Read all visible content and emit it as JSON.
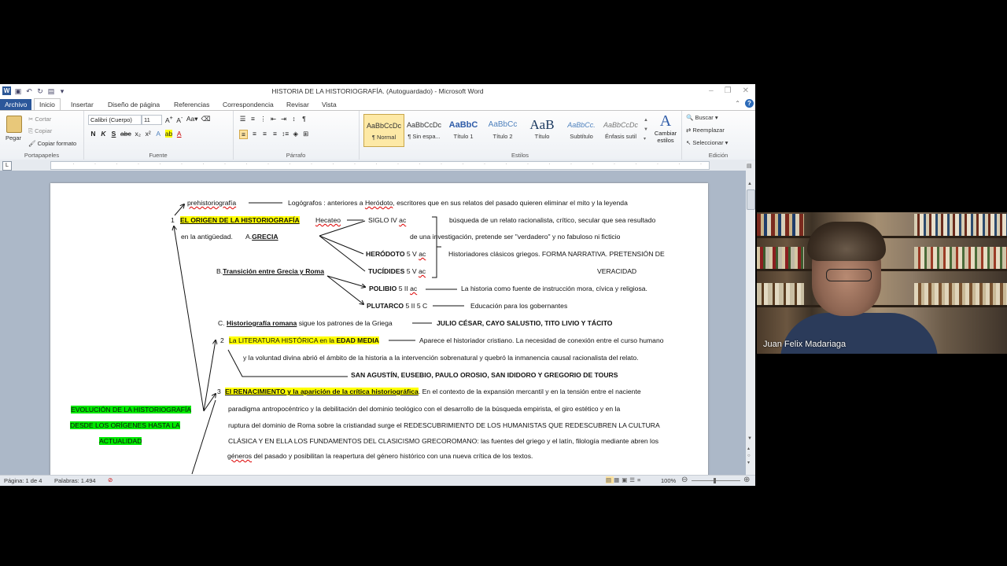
{
  "window": {
    "title": "HISTORIA DE LA HISTORIOGRAFÍA. (Autoguardado) - Microsoft Word",
    "app_icon": "W"
  },
  "ribbon_tabs": [
    "Archivo",
    "Inicio",
    "Insertar",
    "Diseño de página",
    "Referencias",
    "Correspondencia",
    "Revisar",
    "Vista"
  ],
  "clipboard": {
    "paste": "Pegar",
    "cut": "Cortar",
    "copy": "Copiar",
    "format_painter": "Copiar formato",
    "label": "Portapapeles"
  },
  "font": {
    "name": "Calibri (Cuerpo)",
    "size": "11",
    "label": "Fuente",
    "bold": "N",
    "italic": "K",
    "underline": "S"
  },
  "paragraph": {
    "label": "Párrafo"
  },
  "styles": {
    "label": "Estilos",
    "items": [
      {
        "preview": "AaBbCcDc",
        "name": "¶ Normal"
      },
      {
        "preview": "AaBbCcDc",
        "name": "¶ Sin espa..."
      },
      {
        "preview": "AaBbC",
        "name": "Título 1"
      },
      {
        "preview": "AaBbCc",
        "name": "Título 2"
      },
      {
        "preview": "AaB",
        "name": "Título"
      },
      {
        "preview": "AaBbCc.",
        "name": "Subtítulo"
      },
      {
        "preview": "AaBbCcDc",
        "name": "Énfasis sutil"
      }
    ],
    "change": "Cambiar estilos"
  },
  "editing": {
    "label": "Edición",
    "find": "Buscar",
    "replace": "Reemplazar",
    "select": "Seleccionar"
  },
  "document": {
    "l1_a": "prehistoriografía",
    "l1_b": "Logógrafos : anteriores a",
    "l1_c": "Heródoto",
    "l1_d": ", escritores que en sus relatos del pasado quieren eliminar el mito y la leyenda",
    "n1": "1",
    "s1": "EL ORIGEN DE LA HISTORIOGRAFÍA",
    "hecateo": "Hecateo",
    "siglo4": "SIGLO IV",
    "ac1": "ac",
    "busq1": "búsqueda de un relato racionalista, crítico, secular que sea resultado",
    "antig": "en la antigüedad.",
    "grecia_a": "A.",
    "grecia": "GRECIA",
    "busq2": "de una investigación, pretende ser \"verdadero\" y no fabuloso ni ficticio",
    "herodoto": "HERÓDOTO",
    "herodoto_s": "5 V",
    "ac2": "ac",
    "clasicos": "Historiadores clásicos griegos. FORMA NARRATIVA. PRETENSIÓN DE",
    "transicion_a": "B.",
    "transicion": "Transición entre Grecia y Roma",
    "tucidides": "TUCÍDIDES",
    "tucidides_s": "5 V",
    "ac3": "ac",
    "veracidad": "VERACIDAD",
    "polibio": "POLIBIO",
    "polibio_s": "5 II",
    "ac4": "ac",
    "polibio_t": "La historia como fuente de instrucción mora, cívica y religiosa.",
    "plutarco": "PLUTARCO",
    "plutarco_s": "5 II 5 C",
    "plutarco_t": "Educación para los gobernantes",
    "roma_a": "C.",
    "roma": "Historiografía romana",
    "roma_b": "sigue los patrones de la Griega",
    "romanos": "JULIO CÉSAR,  CAYO SALUSTIO, TITO LIVIO Y  TÁCITO",
    "n2": "2",
    "s2_a": "La LITERATURA HISTÓRICA en la",
    "s2_b": "EDAD MEDIA",
    "medieval1": "Aparece el historiador cristiano. La necesidad de conexión entre el curso humano",
    "medieval2": "y la voluntad divina abrió el ámbito de la historia a la intervención sobrenatural y quebró la inmanencia causal racionalista del relato.",
    "padres": "SAN AGUSTÍN, EUSEBIO, PAULO OROSIO, SAN IDIDORO Y GREGORIO DE TOURS",
    "n3": "3",
    "s3": "El RENACIMIENTO y la aparición de la crítica historiográfica",
    "ren1": ". En el contexto de la expansión mercantil y en la tensión entre el naciente",
    "ren2": "paradigma antropocéntrico y la debilitación del dominio teológico con el desarrollo de la búsqueda  empirista, el giro  estético y en la",
    "ren3": "ruptura del dominio de Roma sobre la cristiandad surge el REDESCUBRIMIENTO DE LOS HUMANISTAS QUE REDESCUBREN LA CULTURA",
    "ren4": "CLÁSICA Y EN ELLA  LOS FUNDAMENTOS DEL CLASICISMO GRECOROMANO: las fuentes del griego y el latín, filología mediante abren los",
    "ren5_a": "géneros",
    "ren5_b": " del pasado y posibilitan la reapertura del género histórico con una nueva crítica de los textos.",
    "evo1": "EVOLUCIÓN DE LA HISTORIOGRAFÍA",
    "evo2": "DESDE LOS ORÍGENES HASTA LA",
    "evo3": "ACTUALIDAD"
  },
  "status": {
    "page": "Página: 1 de 4",
    "words": "Palabras: 1.494",
    "zoom": "100%"
  },
  "video": {
    "participant": "Juan Felix Madariaga"
  }
}
